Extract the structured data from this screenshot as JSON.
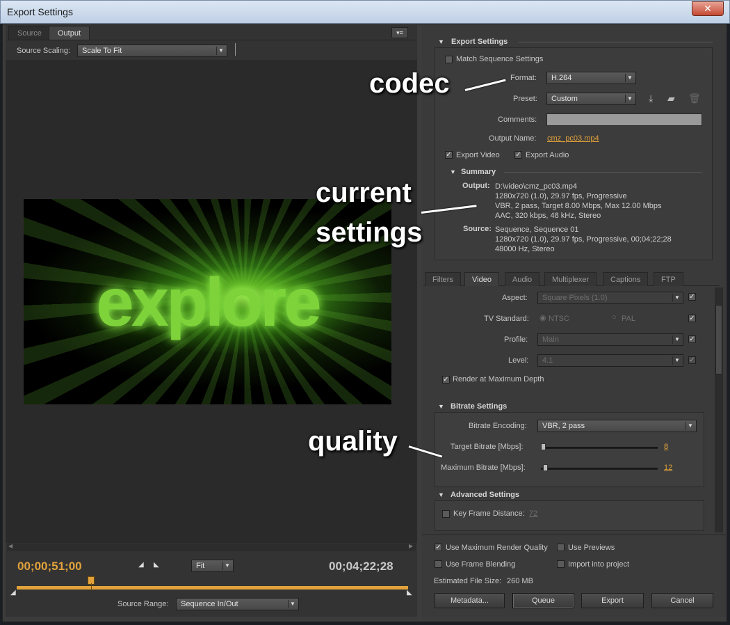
{
  "window": {
    "title": "Export Settings",
    "close_glyph": "✕"
  },
  "left": {
    "tabs": [
      {
        "label": "Source"
      },
      {
        "label": "Output"
      }
    ],
    "panel_menu_glyph": "▾≡",
    "source_scaling_label": "Source Scaling:",
    "source_scaling_value": "Scale To Fit",
    "video_title_text": "explore",
    "current_timecode": "00;00;51;00",
    "duration_timecode": "00;04;22;28",
    "zoom_value": "Fit",
    "source_range_label": "Source Range:",
    "source_range_value": "Sequence In/Out",
    "playhead_fraction": 0.19
  },
  "export_settings": {
    "header": "Export Settings",
    "match_sequence_label": "Match Sequence Settings",
    "format_label": "Format:",
    "format_value": "H.264",
    "preset_label": "Preset:",
    "preset_value": "Custom",
    "comments_label": "Comments:",
    "output_name_label": "Output Name:",
    "output_name_value": "cmz_pc03.mp4",
    "export_video_label": "Export Video",
    "export_audio_label": "Export Audio",
    "summary_header": "Summary",
    "output_label": "Output:",
    "output_lines": [
      "D:\\video\\cmz_pc03.mp4",
      "1280x720 (1.0), 29.97 fps, Progressive",
      "VBR, 2 pass, Target 8.00 Mbps, Max 12.00 Mbps",
      "AAC, 320 kbps, 48 kHz, Stereo"
    ],
    "source_label": "Source:",
    "source_lines": [
      "Sequence, Sequence 01",
      "1280x720 (1.0), 29.97 fps, Progressive, 00;04;22;28",
      "48000 Hz, Stereo"
    ]
  },
  "tabs": [
    {
      "label": "Filters"
    },
    {
      "label": "Video"
    },
    {
      "label": "Audio"
    },
    {
      "label": "Multiplexer"
    },
    {
      "label": "Captions"
    },
    {
      "label": "FTP"
    }
  ],
  "video": {
    "aspect_label": "Aspect:",
    "aspect_value": "Square Pixels (1.0)",
    "tv_standard_label": "TV Standard:",
    "ntsc_label": "NTSC",
    "pal_label": "PAL",
    "profile_label": "Profile:",
    "profile_value": "Main",
    "level_label": "Level:",
    "level_value": "4.1",
    "render_max_depth_label": "Render at Maximum Depth"
  },
  "bitrate": {
    "header": "Bitrate Settings",
    "encoding_label": "Bitrate Encoding:",
    "encoding_value": "VBR, 2 pass",
    "target_label": "Target Bitrate [Mbps]:",
    "target_value": "8",
    "max_label": "Maximum Bitrate [Mbps]:",
    "max_value": "12"
  },
  "advanced": {
    "header": "Advanced Settings",
    "keyframe_label": "Key Frame Distance:",
    "keyframe_value": "72"
  },
  "bottom": {
    "max_render_quality_label": "Use Maximum Render Quality",
    "use_previews_label": "Use Previews",
    "frame_blending_label": "Use Frame Blending",
    "import_label": "Import into project",
    "file_size_label": "Estimated File Size:",
    "file_size_value": "260 MB",
    "metadata_button": "Metadata...",
    "queue_button": "Queue",
    "export_button": "Export",
    "cancel_button": "Cancel"
  },
  "annotations": {
    "codec": "codec",
    "current_settings_line1": "current",
    "current_settings_line2": "settings",
    "quality": "quality"
  },
  "colors": {
    "accent_orange": "#e2a23b",
    "panel_bg": "#3a3a3a"
  }
}
